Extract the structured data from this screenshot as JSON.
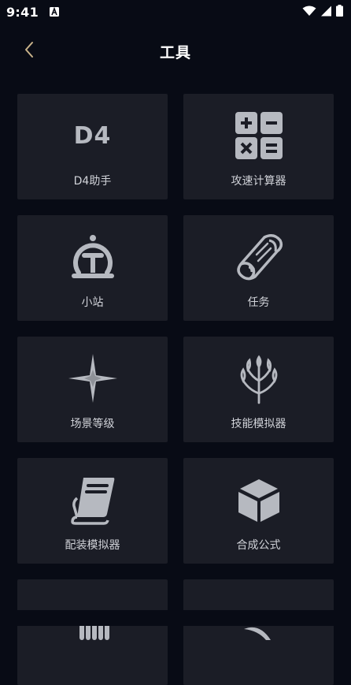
{
  "status_bar": {
    "time": "9:41",
    "notification_icon": "font-a-icon",
    "icons": [
      "wifi-icon",
      "signal-icon",
      "battery-icon"
    ]
  },
  "header": {
    "title": "工具",
    "back_icon": "chevron-left-icon"
  },
  "tools": [
    {
      "label": "D4助手",
      "icon": "d4-logo-icon",
      "icon_text": "D4"
    },
    {
      "label": "攻速计算器",
      "icon": "calculator-icon"
    },
    {
      "label": "小站",
      "icon": "station-icon"
    },
    {
      "label": "任务",
      "icon": "scroll-icon"
    },
    {
      "label": "场景等级",
      "icon": "sparkle-star-icon"
    },
    {
      "label": "技能模拟器",
      "icon": "skill-tree-icon"
    },
    {
      "label": "配装模拟器",
      "icon": "book-icon"
    },
    {
      "label": "合成公式",
      "icon": "cube-icon"
    },
    {
      "label": "",
      "icon": "hand-icon"
    },
    {
      "label": "",
      "icon": "horn-icon"
    }
  ],
  "colors": {
    "background": "#080b15",
    "tile": "#1b1d26",
    "icon": "#b6b9c0",
    "text": "#d0d2d8",
    "accent_back": "#c9b38a"
  }
}
